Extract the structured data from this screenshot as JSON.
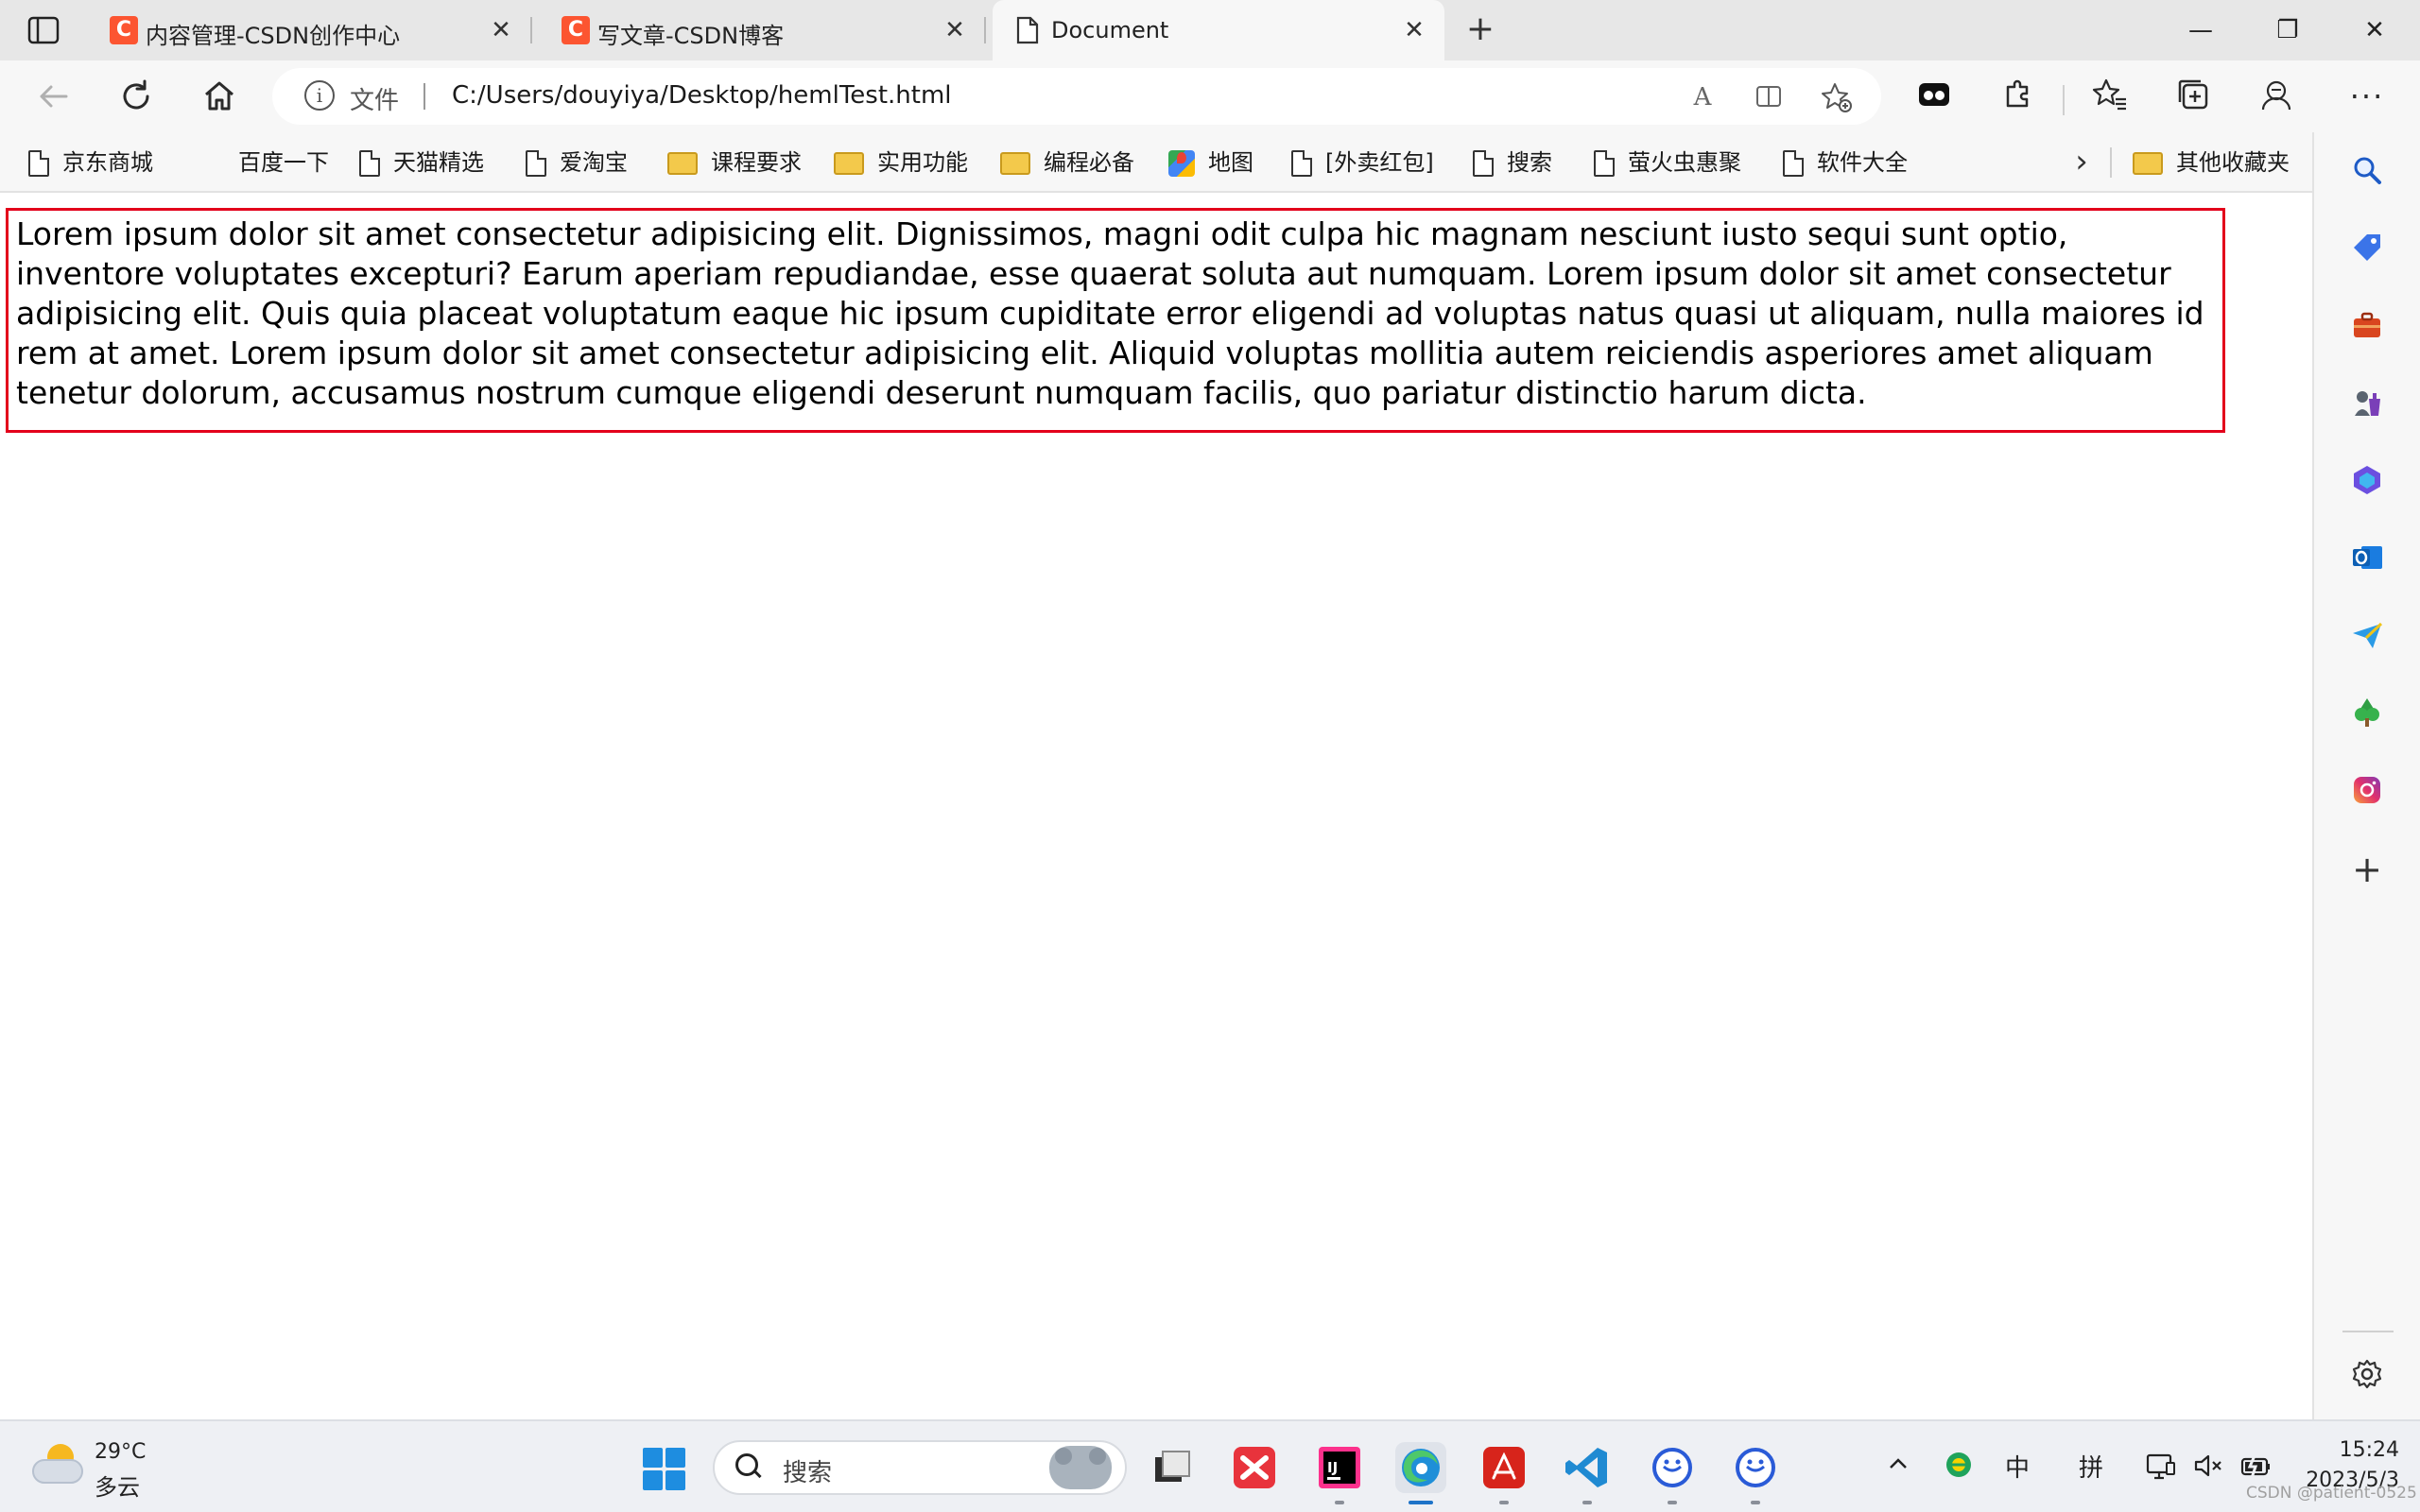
{
  "tabs": [
    {
      "title": "内容管理-CSDN创作中心",
      "favicon": "C",
      "close": "✕"
    },
    {
      "title": "写文章-CSDN博客",
      "favicon": "C",
      "close": "✕"
    },
    {
      "title": "Document",
      "close": "✕"
    }
  ],
  "tabstrip": {
    "new_tab": "+",
    "minimize": "—",
    "restore": "❐",
    "close": "✕"
  },
  "address_bar": {
    "protocol_label": "文件",
    "url": "C:/Users/douyiya/Desktop/hemlTest.html"
  },
  "favorites": [
    {
      "label": "京东商城",
      "icon": "page-icon"
    },
    {
      "label": "百度一下",
      "icon": "none"
    },
    {
      "label": "天猫精选",
      "icon": "page-icon"
    },
    {
      "label": "爱淘宝",
      "icon": "page-icon"
    },
    {
      "label": "课程要求",
      "icon": "folder-icon"
    },
    {
      "label": "实用功能",
      "icon": "folder-icon"
    },
    {
      "label": "编程必备",
      "icon": "folder-icon"
    },
    {
      "label": "地图",
      "icon": "map-icon"
    },
    {
      "label": "[外卖红包]",
      "icon": "page-icon"
    },
    {
      "label": "搜索",
      "icon": "page-icon"
    },
    {
      "label": "萤火虫惠聚",
      "icon": "page-icon"
    },
    {
      "label": "软件大全",
      "icon": "page-icon"
    }
  ],
  "favorites_other": "其他收藏夹",
  "content": {
    "paragraph": "Lorem ipsum dolor sit amet consectetur adipisicing elit. Dignissimos, magni odit culpa hic magnam nesciunt iusto sequi sunt optio, inventore voluptates excepturi? Earum aperiam repudiandae, esse quaerat soluta aut numquam. Lorem ipsum dolor sit amet consectetur adipisicing elit. Quis quia placeat voluptatum eaque hic ipsum cupiditate error eligendi ad voluptas natus quasi ut aliquam, nulla maiores id rem at amet. Lorem ipsum dolor sit amet consectetur adipisicing elit. Aliquid voluptas mollitia autem reiciendis asperiores amet aliquam tenetur dolorum, accusamus nostrum cumque eligendi deserunt numquam facilis, quo pariatur distinctio harum dicta.",
    "border_color": "#e3001b"
  },
  "taskbar": {
    "weather_temp": "29°C",
    "weather_desc": "多云",
    "search_placeholder": "搜索",
    "ime_lang": "中",
    "ime_mode": "拼",
    "time": "15:24",
    "date": "2023/5/3",
    "watermark": "CSDN @patient-0525"
  },
  "colors": {
    "csdn_brand": "#fc5531",
    "accent": "#1e73c8"
  }
}
